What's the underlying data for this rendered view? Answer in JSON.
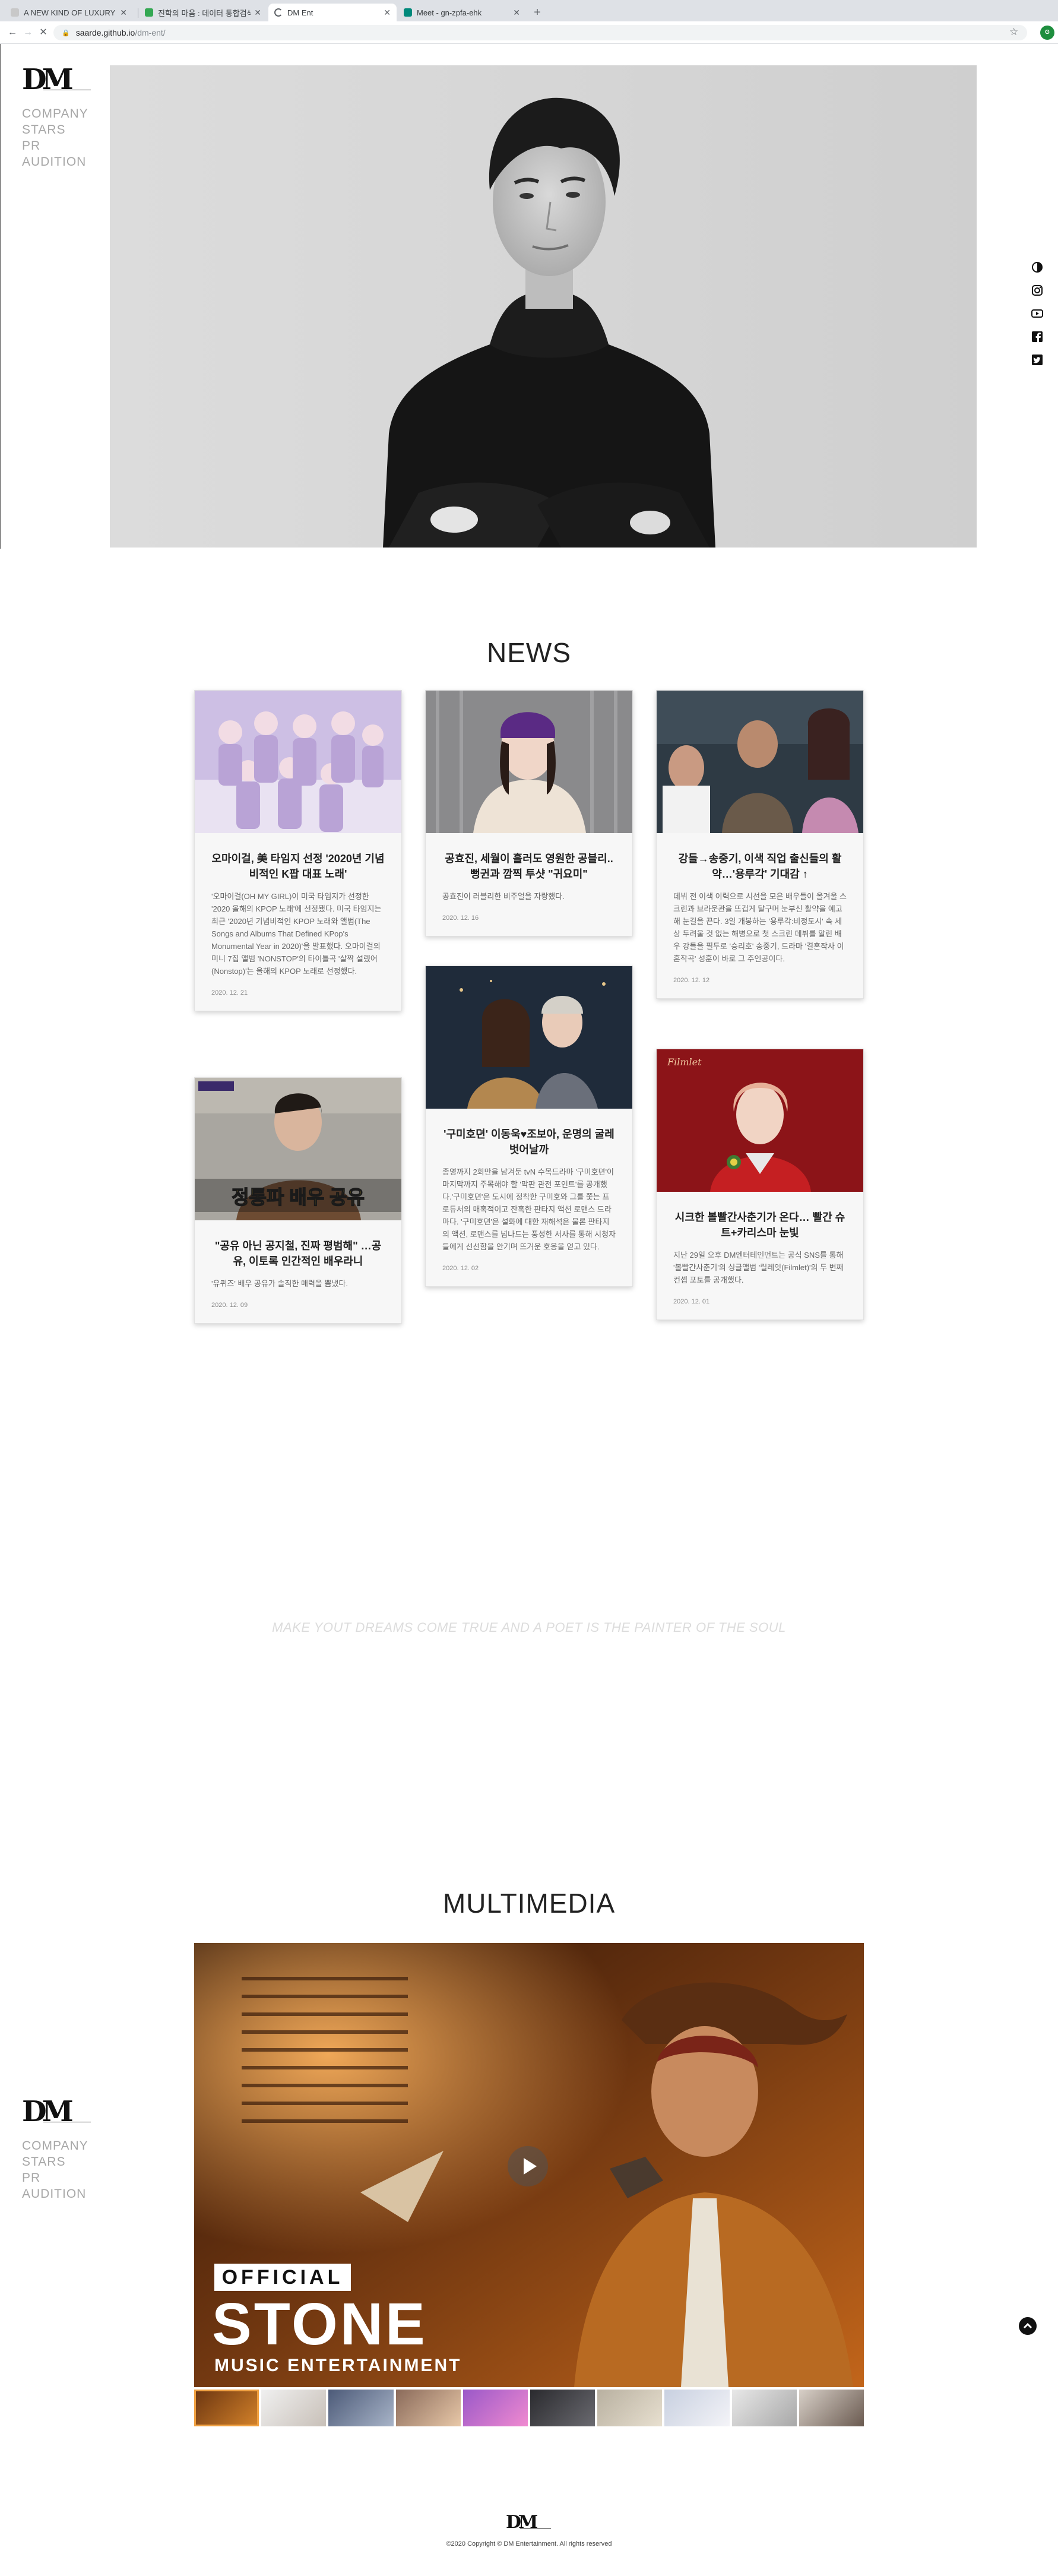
{
  "browser": {
    "tabs": [
      {
        "label": "A NEW KIND OF LUXURY",
        "active": false
      },
      {
        "label": "진학의 마음 : 데이터 통합검색",
        "active": false
      },
      {
        "label": "DM Ent",
        "active": true
      },
      {
        "label": "Meet - gn-zpfa-ehk",
        "active": false
      }
    ],
    "url_host": "saarde.github.io",
    "url_path": "/dm-ent/"
  },
  "sidebar": {
    "nav": [
      "COMPANY",
      "STARS",
      "PR",
      "AUDITION"
    ]
  },
  "social_icons": [
    "contrast-icon",
    "instagram-icon",
    "youtube-icon",
    "facebook-icon",
    "twitter-icon"
  ],
  "news": {
    "title": "NEWS",
    "cards": [
      {
        "title": "오마이걸, 美 타임지 선정 '2020년 기념비적인 K팝 대표 노래'",
        "body": "'오마이걸(OH MY GIRL)이 미국 타임지가 선정한 '2020 올해의 KPOP 노래'에 선정됐다. 미국 타임지는 최근 '2020년 기념비적인 KPOP 노래와 앨범(The Songs and Albums That Defined KPop's Monumental Year in 2020)'을 발표했다. 오마이걸의 미니 7집 앨범 'NONSTOP'의 타이틀곡 '살짝 설렜어(Nonstop)'는 올해의 KPOP 노래로 선정했다.",
        "date": "2020. 12. 21"
      },
      {
        "title": "공효진, 세월이 흘러도 영원한 공블리.. 뻥귄과 깜찍 투샷 \"귀요미\"",
        "body": "공효진이 러블리한 비주얼을 자랑했다.",
        "date": "2020. 12. 16"
      },
      {
        "title": "강들→송중기, 이색 직업 출신들의 활약…'용루각' 기대감 ↑",
        "body": "데뷔 전 이색 이력으로 시선을 모은 배우들이 올겨울 스크린과 브라운관을 뜨겁게 달구며 눈부신 활약을 예고해 눈길을 끈다. 3일 개봉하는 '용루각:비정도시' 속 세상 두려울 것 없는 해병으로 첫 스크린 데뷔를 알린 배우 강들을 필두로 '승리호' 송중기, 드라마 '결혼작사 이혼작곡' 성훈이 바로 그 주인공이다.",
        "date": "2020. 12. 12"
      },
      {
        "title": "'구미호뎐' 이동욱♥조보아, 운명의 굴레 벗어날까",
        "body": "종영까지 2회만을 남겨둔 tvN 수목드라마 '구미호뎐'이 마지막까지 주목해야 할 '막판 관전 포인트'를 공개했다.'구미호뎐'은 도시에 정착한 구미호와 그를 쫓는 프로듀서의 매혹적이고 잔혹한 판타지 액션 로맨스 드라마다. '구미호뎐'은 설화에 대한 재해석은 물론 판타지의 액션, 로맨스를 넘나드는 풍성한 서사를 통해 시청자들에게 선선함을 안기며 뜨거운 호응을 얻고 있다.",
        "date": "2020. 12. 02"
      },
      {
        "title": "\"공유 아닌 공지철, 진짜 평범해\" …공유, 이토록 인간적인 배우라니",
        "body": "'유퀴즈' 배우 공유가 솔직한 매력을 뽐냈다.",
        "date": "2020. 12. 09",
        "thumb_caption": "정통파 배우 공유"
      },
      {
        "title": "시크한 볼빨간사춘기가 온다… 빨간 슈트+카리스마 눈빛",
        "body": "지난 29일 오후 DM엔터테인먼트는 공식 SNS를 통해 '볼빨간사춘기'의 싱글앨범 '릴레잇(Filmlet)'의 두 번째 컨셉 포토를 공개했다.",
        "date": "2020. 12. 01",
        "thumb_caption": "Filmlet"
      }
    ]
  },
  "quote": "MAKE YOUT DREAMS COME TRUE AND A POET IS THE PAINTER OF THE SOUL",
  "multimedia": {
    "title": "MULTIMEDIA",
    "video_caption": {
      "line1": "OFFICIAL",
      "line2": "STONE",
      "line3": "MUSIC ENTERTAINMENT"
    },
    "thumb_count": 10
  },
  "footer": {
    "copyright": "©2020 Copyright © DM Entertainment. All rights reserved"
  },
  "colors": {
    "accent_orange": "#e8902a",
    "nav_gray": "#a7a7a7",
    "card_bg": "#f7f7f7"
  }
}
